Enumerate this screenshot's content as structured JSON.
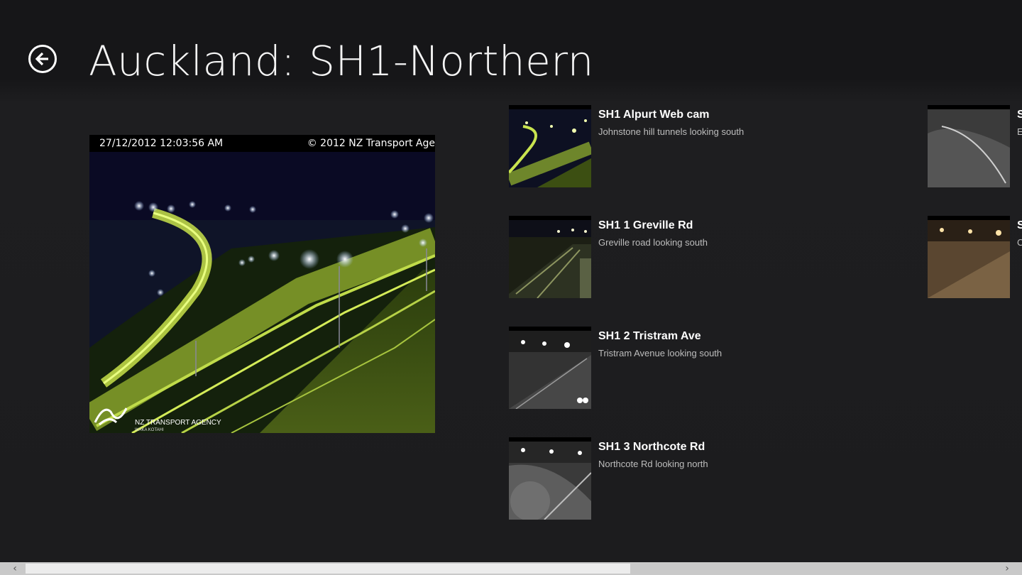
{
  "header": {
    "title": "Auckland: SH1-Northern",
    "back_icon": "back-arrow-icon"
  },
  "featured": {
    "timestamp": "27/12/2012 12:03:56 AM",
    "copyright": "© 2012 NZ Transport Age",
    "logo_text": "NZ TRANSPORT AGENCY",
    "logo_subtext": "WAKA KOTAHI"
  },
  "cameras": [
    {
      "name": "SH1 Alpurt Web cam",
      "description": "Johnstone hill tunnels looking south"
    },
    {
      "name": "SH1 1 Greville Rd",
      "description": "Greville road looking south"
    },
    {
      "name": "SH1 2 Tristram Ave",
      "description": "Tristram Avenue looking south"
    },
    {
      "name": "SH1 3 Northcote Rd",
      "description": "Northcote Rd looking north"
    }
  ],
  "cameras_col2": [
    {
      "name": "S",
      "description": "E"
    },
    {
      "name": "S",
      "description": "C"
    }
  ],
  "scrollbar": {
    "left_arrow": "‹",
    "right_arrow": "›",
    "position_fraction": 0.0,
    "visible_fraction": 0.6
  },
  "colors": {
    "background": "#1c1c1e",
    "text": "#ffffff",
    "subtext": "#bdbdbd"
  }
}
